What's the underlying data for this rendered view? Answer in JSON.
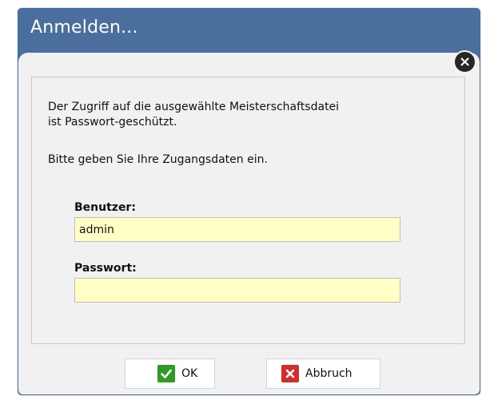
{
  "window": {
    "title": "Anmelden..."
  },
  "message": {
    "line1": "Der Zugriff auf die ausgewählte Meisterschaftsdatei",
    "line2": "ist Passwort-geschützt.",
    "line3": "Bitte geben Sie Ihre Zugangsdaten ein."
  },
  "user": {
    "label": "Benutzer:",
    "value": "admin"
  },
  "password": {
    "label": "Passwort:",
    "value": ""
  },
  "buttons": {
    "ok": "OK",
    "cancel": "Abbruch"
  },
  "icons": {
    "close": "close-icon",
    "ok": "checkmark-icon",
    "cancel": "x-icon"
  },
  "colors": {
    "title_bar": "#4a6f9f",
    "input_background": "#ffffc6",
    "ok_icon": "#2e9b21",
    "cancel_icon": "#d32e2e"
  }
}
